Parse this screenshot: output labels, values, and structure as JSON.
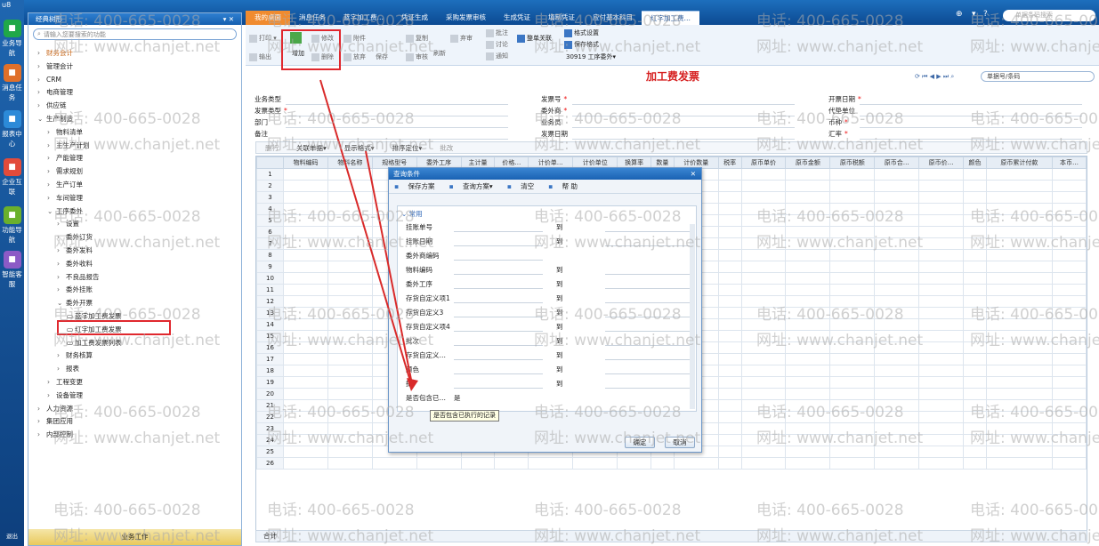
{
  "app": {
    "logo": "u8"
  },
  "rail": [
    {
      "label": "业务导航",
      "icon": "grid-icon",
      "color": "#20a848"
    },
    {
      "label": "消息任务",
      "icon": "mail-icon",
      "color": "#e0702a"
    },
    {
      "label": "报表中心",
      "icon": "chart-icon",
      "color": "#2c8ad8"
    },
    {
      "label": "企业互联",
      "icon": "link-icon",
      "color": "#e24b3b"
    },
    {
      "label": "功能导航",
      "icon": "compass-icon",
      "color": "#6ab02c"
    },
    {
      "label": "智能客服",
      "icon": "headset-icon",
      "color": "#8c5bc6"
    },
    {
      "label": "退出",
      "icon": "exit-icon",
      "color": "#1f66b0"
    }
  ],
  "nav": {
    "title": "经典树形",
    "search_placeholder": "请输入您要搜索的功能",
    "footer": "业务工作",
    "items": [
      {
        "label": "财务会计",
        "arrow": "›",
        "level": 0
      },
      {
        "label": "管理会计",
        "arrow": "›",
        "level": 0
      },
      {
        "label": "CRM",
        "arrow": "›",
        "level": 0
      },
      {
        "label": "电商管理",
        "arrow": "›",
        "level": 0
      },
      {
        "label": "供应链",
        "arrow": "›",
        "level": 0
      },
      {
        "label": "生产制造",
        "arrow": "⌄",
        "level": 0
      },
      {
        "label": "物料清单",
        "arrow": "›",
        "level": 1
      },
      {
        "label": "主生产计划",
        "arrow": "›",
        "level": 1
      },
      {
        "label": "产能管理",
        "arrow": "›",
        "level": 1
      },
      {
        "label": "需求规划",
        "arrow": "›",
        "level": 1
      },
      {
        "label": "生产订单",
        "arrow": "›",
        "level": 1
      },
      {
        "label": "车间管理",
        "arrow": "›",
        "level": 1
      },
      {
        "label": "工序委外",
        "arrow": "⌄",
        "level": 1
      },
      {
        "label": "设置",
        "arrow": "›",
        "level": 2
      },
      {
        "label": "委外订货",
        "arrow": "›",
        "level": 2
      },
      {
        "label": "委外发料",
        "arrow": "›",
        "level": 2
      },
      {
        "label": "委外收料",
        "arrow": "›",
        "level": 2
      },
      {
        "label": "不良品报告",
        "arrow": "›",
        "level": 2
      },
      {
        "label": "委外挂账",
        "arrow": "›",
        "level": 2
      },
      {
        "label": "委外开票",
        "arrow": "⌄",
        "level": 2
      },
      {
        "label": "蓝字加工费发票",
        "arrow": "",
        "level": 3
      },
      {
        "label": "红字加工费发票",
        "arrow": "",
        "level": 3
      },
      {
        "label": "加工费发票列表",
        "arrow": "",
        "level": 3
      },
      {
        "label": "财务核算",
        "arrow": "›",
        "level": 2
      },
      {
        "label": "报表",
        "arrow": "›",
        "level": 2
      },
      {
        "label": "工程变更",
        "arrow": "›",
        "level": 1
      },
      {
        "label": "设备管理",
        "arrow": "›",
        "level": 1
      },
      {
        "label": "人力资源",
        "arrow": "›",
        "level": 0
      },
      {
        "label": "集团应用",
        "arrow": "›",
        "level": 0
      },
      {
        "label": "内部控制",
        "arrow": "›",
        "level": 0
      }
    ]
  },
  "tabs": [
    "我的桌面",
    "消息任务",
    "蓝字加工费…",
    "凭证生成",
    "采购发票审核",
    "生成凭证",
    "填制凭证",
    "应付基本科目",
    "红字加工费…"
  ],
  "top": {
    "search_placeholder": "单据条码搜索"
  },
  "toolbar": {
    "print": "打印",
    "output": "输出",
    "add": "增加",
    "modify": "修改",
    "delete": "删除",
    "attach": "附件",
    "abandon": "放弃",
    "save": "保存",
    "copy": "复制",
    "approve": "审核",
    "refresh": "刷新",
    "audit": "弃审",
    "batch": "批注",
    "discuss": "讨论",
    "notify": "通知",
    "print_mode": "整单关联",
    "format_settings": "格式设置",
    "save_format": "保存格式",
    "template": "30919 工序委外▾"
  },
  "form": {
    "title": "加工费发票",
    "nav_search": "单据号/条码",
    "fields": [
      {
        "label": "业务类型",
        "req": ""
      },
      {
        "label": "发票类型",
        "req": "*"
      },
      {
        "label": "部门",
        "req": ""
      },
      {
        "label": "备注",
        "req": ""
      },
      {
        "label": "发票号",
        "req": "*"
      },
      {
        "label": "委外商",
        "req": "*"
      },
      {
        "label": "业务员",
        "req": ""
      },
      {
        "label": "发票日期",
        "req": ""
      },
      {
        "label": "开票日期",
        "req": "*"
      },
      {
        "label": "代垫单位",
        "req": ""
      },
      {
        "label": "币种",
        "req": "*"
      },
      {
        "label": "汇率",
        "req": "*"
      }
    ]
  },
  "grid_tools": [
    "删行",
    "关联单据▾",
    "显示格式▾",
    "排序定位▾",
    "批改"
  ],
  "grid": {
    "columns": [
      "物料编码",
      "物料名称",
      "规格型号",
      "委外工序",
      "主计量",
      "价格…",
      "计价单…",
      "计价单位",
      "换算率",
      "数量",
      "计价数量",
      "税率",
      "原币单价",
      "原币金额",
      "原币税额",
      "原币合…",
      "原币价…",
      "颜色",
      "原币累计付款",
      "本币…"
    ],
    "rows": 26,
    "total": "合计"
  },
  "dialog": {
    "title": "查询条件",
    "tools": [
      "保存方案",
      "查询方案▾",
      "清空",
      "帮 助"
    ],
    "group": "常用",
    "to": "到",
    "criteria": [
      {
        "label": "挂账单号",
        "range": true
      },
      {
        "label": "挂账日期",
        "range": true
      },
      {
        "label": "委外商编码",
        "range": false
      },
      {
        "label": "物料编码",
        "range": true
      },
      {
        "label": "委外工序",
        "range": true
      },
      {
        "label": "存货自定义项1",
        "range": true
      },
      {
        "label": "存货自定义3",
        "range": true
      },
      {
        "label": "存货自定义项4",
        "range": true
      },
      {
        "label": "批次",
        "range": true
      },
      {
        "label": "存货自定义…",
        "range": true
      },
      {
        "label": "颜色",
        "range": true
      },
      {
        "label": "批",
        "range": true
      },
      {
        "label": "是否包含已…",
        "range": false,
        "value": "是"
      }
    ],
    "tooltip": "是否包含已执行的记录",
    "ok": "确定",
    "cancel": "取消"
  },
  "watermarks": [
    "电话: 400-665-0028",
    "网址: www.chanjet.net"
  ]
}
